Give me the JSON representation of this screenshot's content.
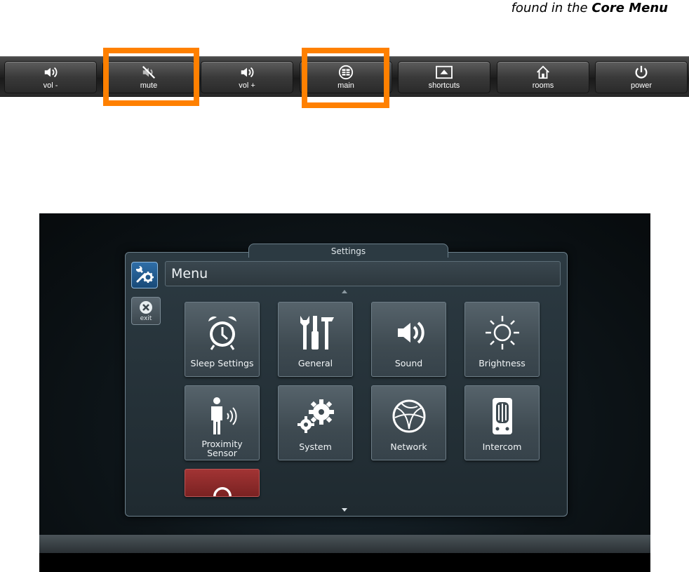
{
  "caption": {
    "prefix": "found in the ",
    "emphasis": "Core Menu"
  },
  "core_menu": {
    "buttons": [
      {
        "label": "vol -",
        "icon": "speaker-icon"
      },
      {
        "label": "mute",
        "icon": "mute-icon"
      },
      {
        "label": "vol +",
        "icon": "speaker-icon"
      },
      {
        "label": "main",
        "icon": "grid-icon"
      },
      {
        "label": "shortcuts",
        "icon": "up-triangle-icon"
      },
      {
        "label": "rooms",
        "icon": "home-icon"
      },
      {
        "label": "power",
        "icon": "power-icon"
      }
    ],
    "highlight_color": "#ff8000"
  },
  "settings": {
    "title": "Settings",
    "menu_label": "Menu",
    "exit_label": "exit",
    "tiles": [
      {
        "label": "Sleep Settings",
        "icon": "alarm-clock-icon"
      },
      {
        "label": "General",
        "icon": "tools-icon"
      },
      {
        "label": "Sound",
        "icon": "speaker-icon"
      },
      {
        "label": "Brightness",
        "icon": "sun-icon"
      },
      {
        "label_line1": "Proximity",
        "label_line2": "Sensor",
        "icon": "proximity-sensor-icon"
      },
      {
        "label": "System",
        "icon": "gears-icon"
      },
      {
        "label": "Network",
        "icon": "globe-icon"
      },
      {
        "label": "Intercom",
        "icon": "intercom-icon"
      }
    ],
    "accent_color": "#1d5a91"
  }
}
